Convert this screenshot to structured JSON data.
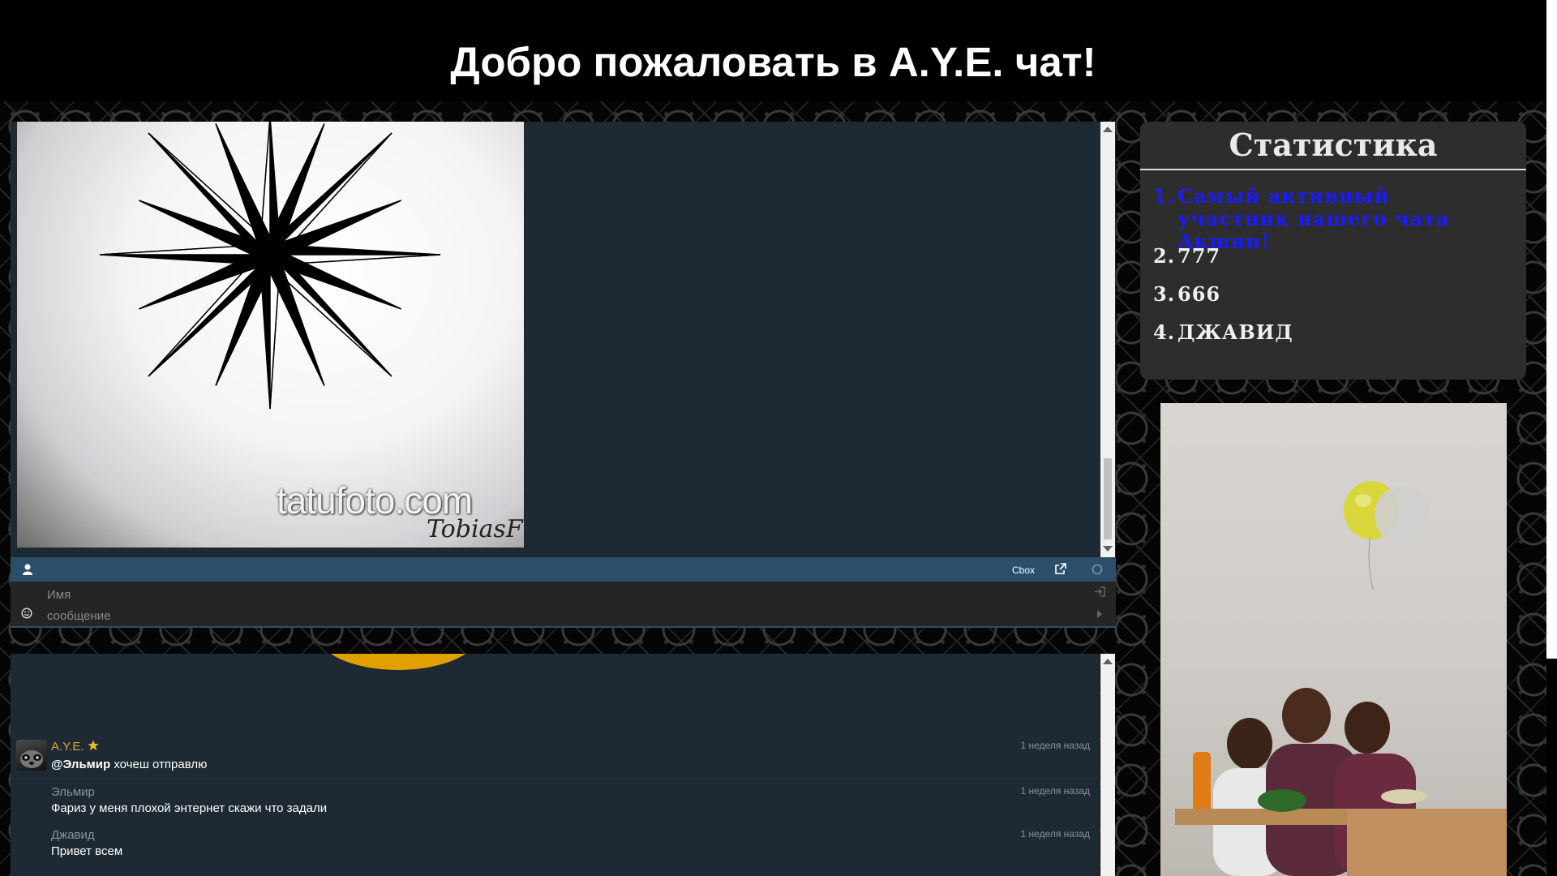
{
  "page": {
    "title": "Добро пожаловать в A.Y.E. чат!"
  },
  "chat_top": {
    "image_watermark": "tatufoto.com",
    "image_signature": "TobiasF",
    "cbox_label": "Cbox",
    "name_placeholder": "Имя",
    "message_placeholder": "сообщение"
  },
  "chat_messages": [
    {
      "name": "A.Y.E.",
      "name_color": "#e2a233",
      "has_star": true,
      "mention": "@Эльмир",
      "text": " хочеш отправлю",
      "time": "1 неделя назад"
    },
    {
      "name": "Эльмир",
      "name_color": "#8a9299",
      "text": "Фариз у меня плохой энтернет скажи что задали",
      "time": "1 неделя назад"
    },
    {
      "name": "Джавид",
      "name_color": "#8a9299",
      "text": "Привет всем",
      "time": "1 неделя назад"
    }
  ],
  "stats": {
    "title": "Статистика",
    "items": [
      {
        "num": "1.",
        "text": "Самый активный участник нашего чата Акшин!",
        "color": "#1a1aff"
      },
      {
        "num": "2.",
        "text": "777"
      },
      {
        "num": "3.",
        "text": "666"
      },
      {
        "num": "4.",
        "text": "ДЖАВИД"
      }
    ]
  },
  "icons": {
    "user": "user-icon",
    "external": "external-link-icon",
    "status": "status-circle-icon",
    "emoji": "smiley-icon",
    "login": "login-icon",
    "send": "send-arrow-icon",
    "star": "star-icon"
  }
}
